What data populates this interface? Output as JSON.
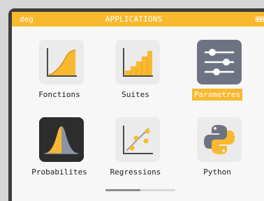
{
  "status_bar": {
    "angle_mode": "deg",
    "title": "APPLICATIONS",
    "icon": "battery-icon",
    "color": "#f9b92e"
  },
  "apps": [
    {
      "label": "Fonctions",
      "icon": "function-graph-icon",
      "selected": false
    },
    {
      "label": "Suites",
      "icon": "sequence-steps-icon",
      "selected": false
    },
    {
      "label": "Parametres",
      "icon": "settings-sliders-icon",
      "selected": true
    },
    {
      "label": "Probabilites",
      "icon": "bell-curve-icon",
      "selected": false
    },
    {
      "label": "Regressions",
      "icon": "scatter-plot-icon",
      "selected": false
    },
    {
      "label": "Python",
      "icon": "python-logo-icon",
      "selected": false
    }
  ],
  "scrollbar": {
    "position": 0.0,
    "visible_fraction": 0.5
  },
  "colors": {
    "accent": "#f9b92e",
    "selection_text": "#ffffff",
    "frame": "#3c3c3c",
    "screen": "#f7f7f7"
  }
}
